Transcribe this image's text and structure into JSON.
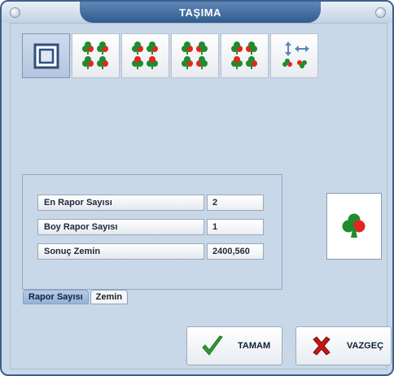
{
  "window": {
    "title": "TAŞIMA"
  },
  "toolbar": {
    "buttons": [
      {
        "icon": "square-frame-icon",
        "active": true
      },
      {
        "icon": "club-pattern-1-icon"
      },
      {
        "icon": "club-pattern-2-icon"
      },
      {
        "icon": "club-pattern-3-icon"
      },
      {
        "icon": "club-pattern-4-icon"
      },
      {
        "icon": "move-arrows-icon"
      }
    ]
  },
  "fields": [
    {
      "label": "En Rapor Sayısı",
      "value": "2"
    },
    {
      "label": "Boy Rapor Sayısı",
      "value": "1"
    },
    {
      "label": "Sonuç Zemin",
      "value": "2400,560"
    }
  ],
  "tabs": [
    {
      "label": "Rapor Sayısı",
      "active": true
    },
    {
      "label": "Zemin",
      "active": false
    }
  ],
  "preview": {
    "icon": "club-icon"
  },
  "actions": {
    "ok_label": "TAMAM",
    "cancel_label": "VAZGEÇ"
  },
  "colors": {
    "title_bar": "#3a6699",
    "panel": "#c8d8e9",
    "club_green": "#1f8c2e",
    "club_red": "#e4261f",
    "check_green": "#2f9a2f",
    "cross_red": "#c51616"
  }
}
